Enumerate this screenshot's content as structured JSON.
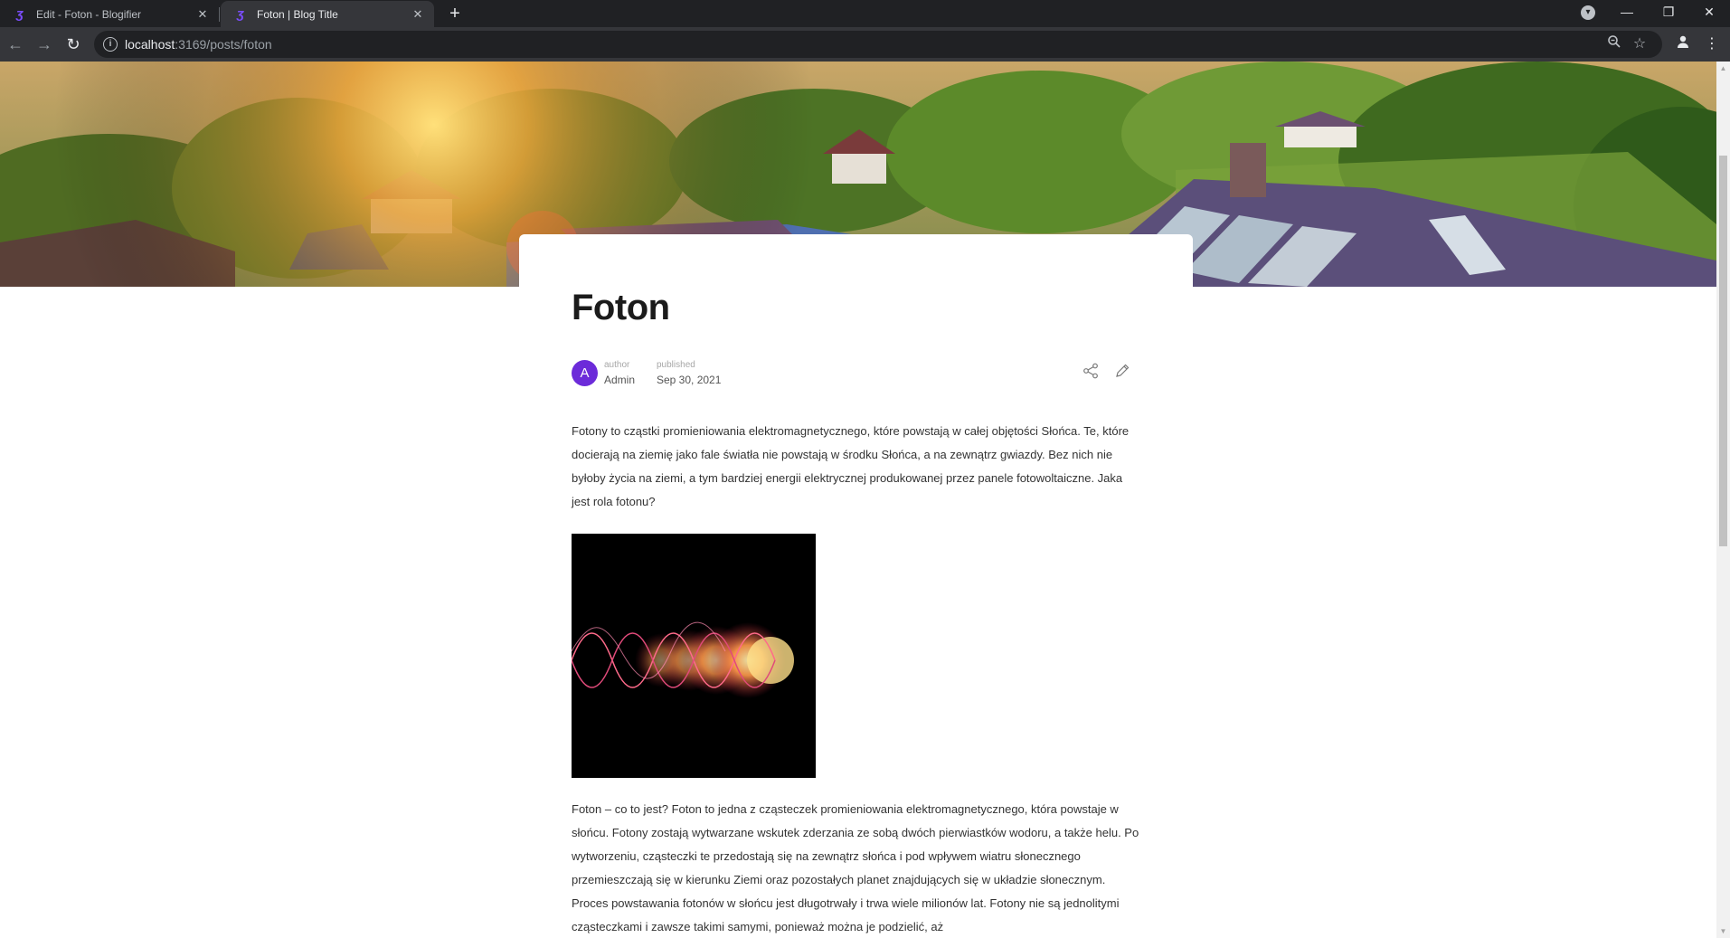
{
  "browser": {
    "tabs": [
      {
        "title": "Edit - Foton - Blogifier",
        "favicon": "blogifier-logo-icon",
        "active": false
      },
      {
        "title": "Foton | Blog Title",
        "favicon": "blogifier-logo-icon",
        "active": true
      }
    ],
    "url_host": "localhost",
    "url_path": ":3169/posts/foton"
  },
  "post": {
    "title": "Foton",
    "author_label": "author",
    "author_name": "Admin",
    "author_initial": "A",
    "published_label": "published",
    "published_date": "Sep 30, 2021",
    "paragraphs": [
      "Fotony to cząstki promieniowania elektromagnetycznego, które powstają w całej objętości Słońca. Te, które docierają na ziemię jako fale światła nie powstają w środku Słońca, a na zewnątrz gwiazdy. Bez nich nie byłoby życia na ziemi, a tym bardziej energii elektrycznej produkowanej przez panele fotowoltaiczne. Jaka jest rola fotonu?",
      "Foton – co to jest? Foton to jedna z cząsteczek promieniowania elektromagnetycznego, która pow­staje w słońcu. Fotony zostają wytwarzane wskutek zderzania ze sobą dwóch pierwiastków wodoru, a także helu. Po wytworzeniu, cząsteczki te przedostają się na zewnątrz słońca i pod wpływem wia­tru słonecznego przemieszczają się w kierunku Ziemi oraz pozostałych planet znajdujących się w układzie słonecznym. Proces powstawania fotonów w słońcu jest długotrwały i trwa wiele milionów lat. Fotony nie są jednolitymi cząsteczkami i zawsze takimi samymi, ponieważ można je podzielić, aż"
    ]
  },
  "colors": {
    "avatar": "#6c2bd9",
    "favicon": "#7b4dff"
  }
}
